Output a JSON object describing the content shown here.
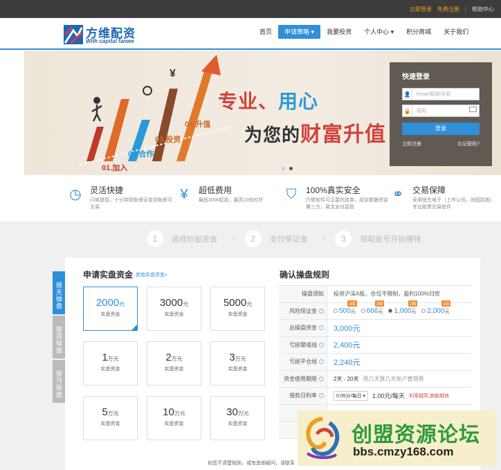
{
  "topbar": {
    "login": "立即登录",
    "register": "免费注册",
    "separator": "|",
    "help": "帮助中心"
  },
  "brand": {
    "name_cn": "方维配资",
    "name_en": "With capital fanwe"
  },
  "nav": {
    "items": [
      "首页",
      "申请策略",
      "我要投资",
      "个人中心",
      "积分商城",
      "关于我们"
    ],
    "active": "申请策略"
  },
  "hero": {
    "slogan_line1_a": "专业、",
    "slogan_line1_b": "用心",
    "slogan_line2_a": "为您的",
    "slogan_line2_b": "财富升值",
    "steps": [
      "01.加入",
      "02.合作",
      "03.投资",
      "04.升值"
    ],
    "currency_symbol": "¥"
  },
  "login_box": {
    "title": "快速登录",
    "account_placeholder": "Email/昵称/手机",
    "password_placeholder": "密码",
    "login_button": "登录",
    "register_link": "立即注册",
    "forgot_link": "忘记密码?"
  },
  "features": [
    {
      "title": "灵活快捷",
      "desc": "闪电提现，十分钟到账保证金到账即可交易"
    },
    {
      "title": "超低费用",
      "desc": "最低3000起投，最高10倍杠杆"
    },
    {
      "title": "100%真实安全",
      "desc": "行情软件可见委托挂单，成交数据资金第三方，易宝支付监管"
    },
    {
      "title": "交易保障",
      "desc": "采用恒生电子（上市公司，同固控股）专业股票交易软件"
    }
  ],
  "steps": [
    {
      "num": "1",
      "label": "选择炒股资金"
    },
    {
      "num": "2",
      "label": "支付保证金"
    },
    {
      "num": "3",
      "label": "领取账号开始赚钱"
    }
  ],
  "side_tabs": [
    "按天操盘",
    "按周操盘",
    "按月操盘"
  ],
  "apply": {
    "title": "申请实盘资金",
    "other_link": "其他实盘资金»",
    "card_sub": "实盘资金",
    "cards": [
      {
        "num": "2000",
        "unit": "元"
      },
      {
        "num": "3000",
        "unit": "元"
      },
      {
        "num": "5000",
        "unit": "元"
      },
      {
        "num": "1",
        "unit": "万元"
      },
      {
        "num": "2",
        "unit": "万元"
      },
      {
        "num": "3",
        "unit": "万元"
      },
      {
        "num": "5",
        "unit": "万元"
      },
      {
        "num": "10",
        "unit": "万元"
      },
      {
        "num": "30",
        "unit": "万元"
      }
    ]
  },
  "rules": {
    "title": "确认操盘规则",
    "rows": [
      {
        "k": "操盘须知",
        "v": "投资沪深A股，仓位不限制，盈利100%归您"
      },
      {
        "k": "风险保证金"
      },
      {
        "k": "总操盘资金",
        "v": "3,000元"
      },
      {
        "k": "亏损警戒线",
        "v": "2,400元"
      },
      {
        "k": "亏损平仓线",
        "v": "2,240元"
      },
      {
        "k": "资金使用期限",
        "v": "2天 - 20天",
        "v2": "用几天算几天账户管理费"
      },
      {
        "k": "借款日利率",
        "select": "0.05分/每日 ▾",
        "v": "1.00元/每天",
        "note": "利率越高,放款越快"
      },
      {
        "k": ""
      },
      {
        "k": "开"
      }
    ],
    "margins": [
      {
        "val": "500",
        "unit": "元",
        "badge": "4倍"
      },
      {
        "val": "666",
        "unit": "元",
        "badge": "3倍"
      },
      {
        "val": "1,000",
        "unit": "元",
        "badge": "2倍"
      },
      {
        "val": "2,000",
        "unit": "元",
        "badge": "1倍"
      }
    ]
  },
  "bottom_note": "如您不清楚规则，或有其他疑问，请联系",
  "watermark": {
    "title": "创盟资源论坛",
    "url": "bbs.cmzy168.com"
  }
}
